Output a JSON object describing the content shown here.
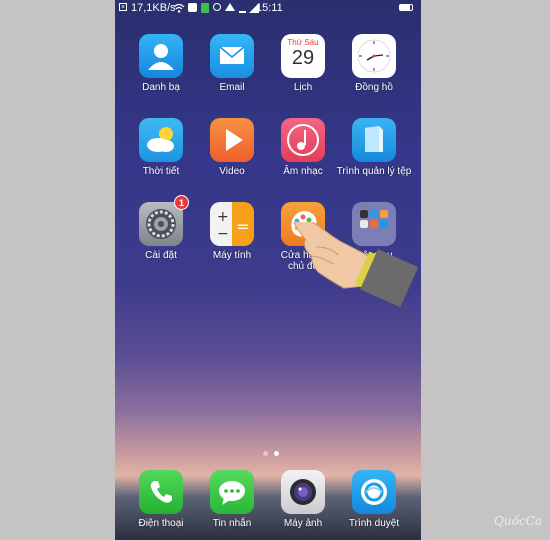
{
  "status_bar": {
    "speed": "17,1KB/s",
    "time": "15:11"
  },
  "apps": {
    "contacts": "Danh bạ",
    "email": "Email",
    "calendar": "Lịch",
    "calendar_day_name": "Thứ Sáu",
    "calendar_day_number": "29",
    "clock": "Đồng hồ",
    "weather": "Thời tiết",
    "video": "Video",
    "music": "Âm nhạc",
    "file_manager": "Trình quản lý tệp",
    "settings": "Cài đặt",
    "settings_badge": "1",
    "calculator": "Máy tính",
    "theme_store": "Cửa hàng chủ đề",
    "tools": "Công cụ"
  },
  "dock": {
    "phone": "Điện thoại",
    "messages": "Tin nhắn",
    "camera": "Máy ảnh",
    "browser": "Trình duyệt"
  },
  "page_indicator": {
    "pages": 2,
    "current": 2
  },
  "watermark": "QuốcCa",
  "colors": {
    "contacts": "#1e9be6",
    "email": "#1ca1ea",
    "video": "#f0773a",
    "music": "#ec4f6a",
    "file_manager": "#1f9fe8",
    "calculator": "#f7a11a",
    "theme_store": "#f28a1f",
    "phone": "#2ebf38",
    "messages": "#33c53e",
    "browser": "#1b9eea"
  }
}
